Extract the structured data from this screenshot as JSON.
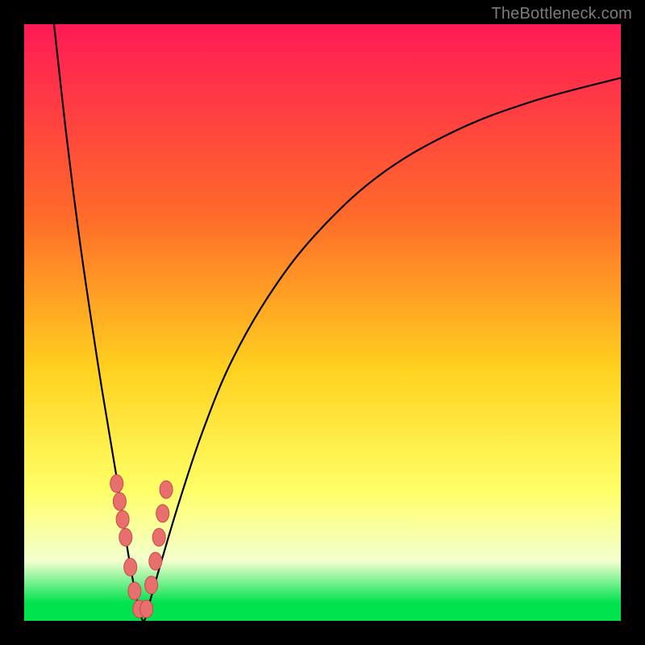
{
  "watermark": "TheBottleneck.com",
  "colors": {
    "frame": "#000000",
    "grad_top": "#ff1a56",
    "grad_mid1": "#ff6a2a",
    "grad_mid2": "#ffd21f",
    "grad_low": "#ffff66",
    "grad_pale": "#f3ffcf",
    "grad_green": "#00e24e",
    "curve": "#000000",
    "marker_fill": "#e76f6e",
    "marker_stroke": "#c94a49"
  },
  "chart_data": {
    "type": "line",
    "title": "",
    "xlabel": "",
    "ylabel": "",
    "xlim": [
      0,
      100
    ],
    "ylim": [
      0,
      100
    ],
    "series": [
      {
        "name": "bottleneck-curve",
        "x": [
          5,
          7,
          9,
          11,
          13,
          15,
          16,
          17,
          18,
          19,
          20,
          21,
          23,
          26,
          30,
          35,
          42,
          50,
          60,
          72,
          85,
          100
        ],
        "y": [
          100,
          82,
          66,
          52,
          39,
          27,
          21,
          14,
          8,
          3,
          0,
          3,
          10,
          20,
          32,
          44,
          56,
          66,
          75,
          82,
          87,
          91
        ]
      }
    ],
    "markers": {
      "name": "highlighted-points",
      "x": [
        15.5,
        16.0,
        16.5,
        17.0,
        17.8,
        18.5,
        19.3,
        20.5,
        21.3,
        22.0,
        22.6,
        23.2,
        23.8
      ],
      "y": [
        23,
        20,
        17,
        14,
        9,
        5,
        2,
        2,
        6,
        10,
        14,
        18,
        22
      ]
    }
  }
}
